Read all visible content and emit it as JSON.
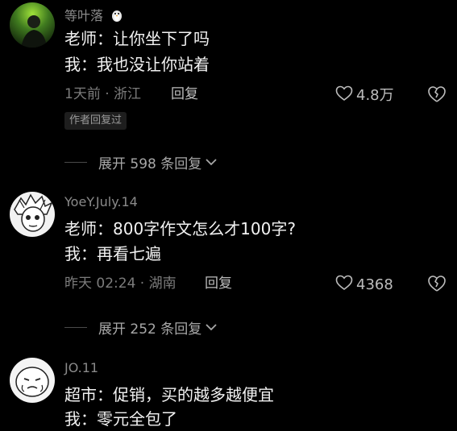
{
  "comments": [
    {
      "username": "等叶落",
      "lines": [
        "老师：让你坐下了吗",
        "我：我也没让你站着"
      ],
      "time_location": "1天前 · 浙江",
      "reply_label": "回复",
      "likes": "4.8万",
      "badge": "作者回复过",
      "expand_label": "展开 598 条回复"
    },
    {
      "username": "YoeY.July.14",
      "lines": [
        "老师：800字作文怎么才100字?",
        "我：再看七遍"
      ],
      "time_location": "昨天 02:24 · 湖南",
      "reply_label": "回复",
      "likes": "4368",
      "expand_label": "展开 252 条回复"
    },
    {
      "username": "JO.11",
      "lines": [
        "超市：促销，买的越多越便宜",
        "我：零元全包了"
      ]
    }
  ],
  "colors": {
    "background": "#000000",
    "text_primary": "#f2f2f2",
    "text_secondary": "#8a8a8a"
  },
  "icons": {
    "username_emoji": "penguin-icon",
    "like": "heart-outline-icon",
    "dislike": "broken-heart-icon",
    "expand": "chevron-down-icon"
  }
}
